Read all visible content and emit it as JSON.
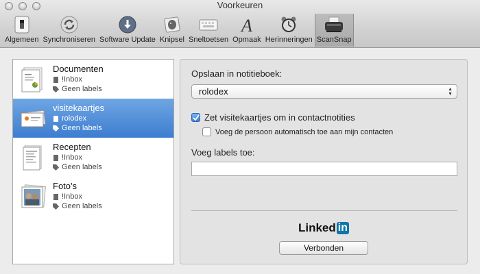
{
  "window": {
    "title": "Voorkeuren"
  },
  "toolbar": {
    "items": [
      {
        "label": "Algemeen",
        "icon": "switch-icon"
      },
      {
        "label": "Synchroniseren",
        "icon": "sync-icon"
      },
      {
        "label": "Software Update",
        "icon": "download-icon"
      },
      {
        "label": "Knipsel",
        "icon": "elephant-icon"
      },
      {
        "label": "Sneltoetsen",
        "icon": "keyboard-icon"
      },
      {
        "label": "Opmaak",
        "icon": "font-icon"
      },
      {
        "label": "Herinneringen",
        "icon": "alarm-clock-icon"
      },
      {
        "label": "ScanSnap",
        "icon": "scanner-icon"
      }
    ],
    "active": "ScanSnap"
  },
  "notebooks": [
    {
      "name": "Documenten",
      "notebook": "!Inbox",
      "labels": "Geen labels",
      "selected": false
    },
    {
      "name": "visitekaartjes",
      "notebook": "rolodex",
      "labels": "Geen labels",
      "selected": true
    },
    {
      "name": "Recepten",
      "notebook": "!Inbox",
      "labels": "Geen labels",
      "selected": false
    },
    {
      "name": "Foto's",
      "notebook": "!Inbox",
      "labels": "Geen labels",
      "selected": false
    }
  ],
  "settings": {
    "save_label": "Opslaan in notitieboek:",
    "notebook_value": "rolodex",
    "convert_label": "Zet visitekaartjes om in contactnotities",
    "convert_checked": true,
    "add_contact_label": "Voeg de persoon automatisch toe aan mijn contacten",
    "add_contact_checked": false,
    "labels_label": "Voeg labels toe:",
    "labels_value": "",
    "linkedin_text": "Linked",
    "linkedin_in": "in",
    "connect_button": "Verbonden"
  },
  "colors": {
    "selection": "#3d7dd0",
    "linkedin": "#0e76a8"
  }
}
